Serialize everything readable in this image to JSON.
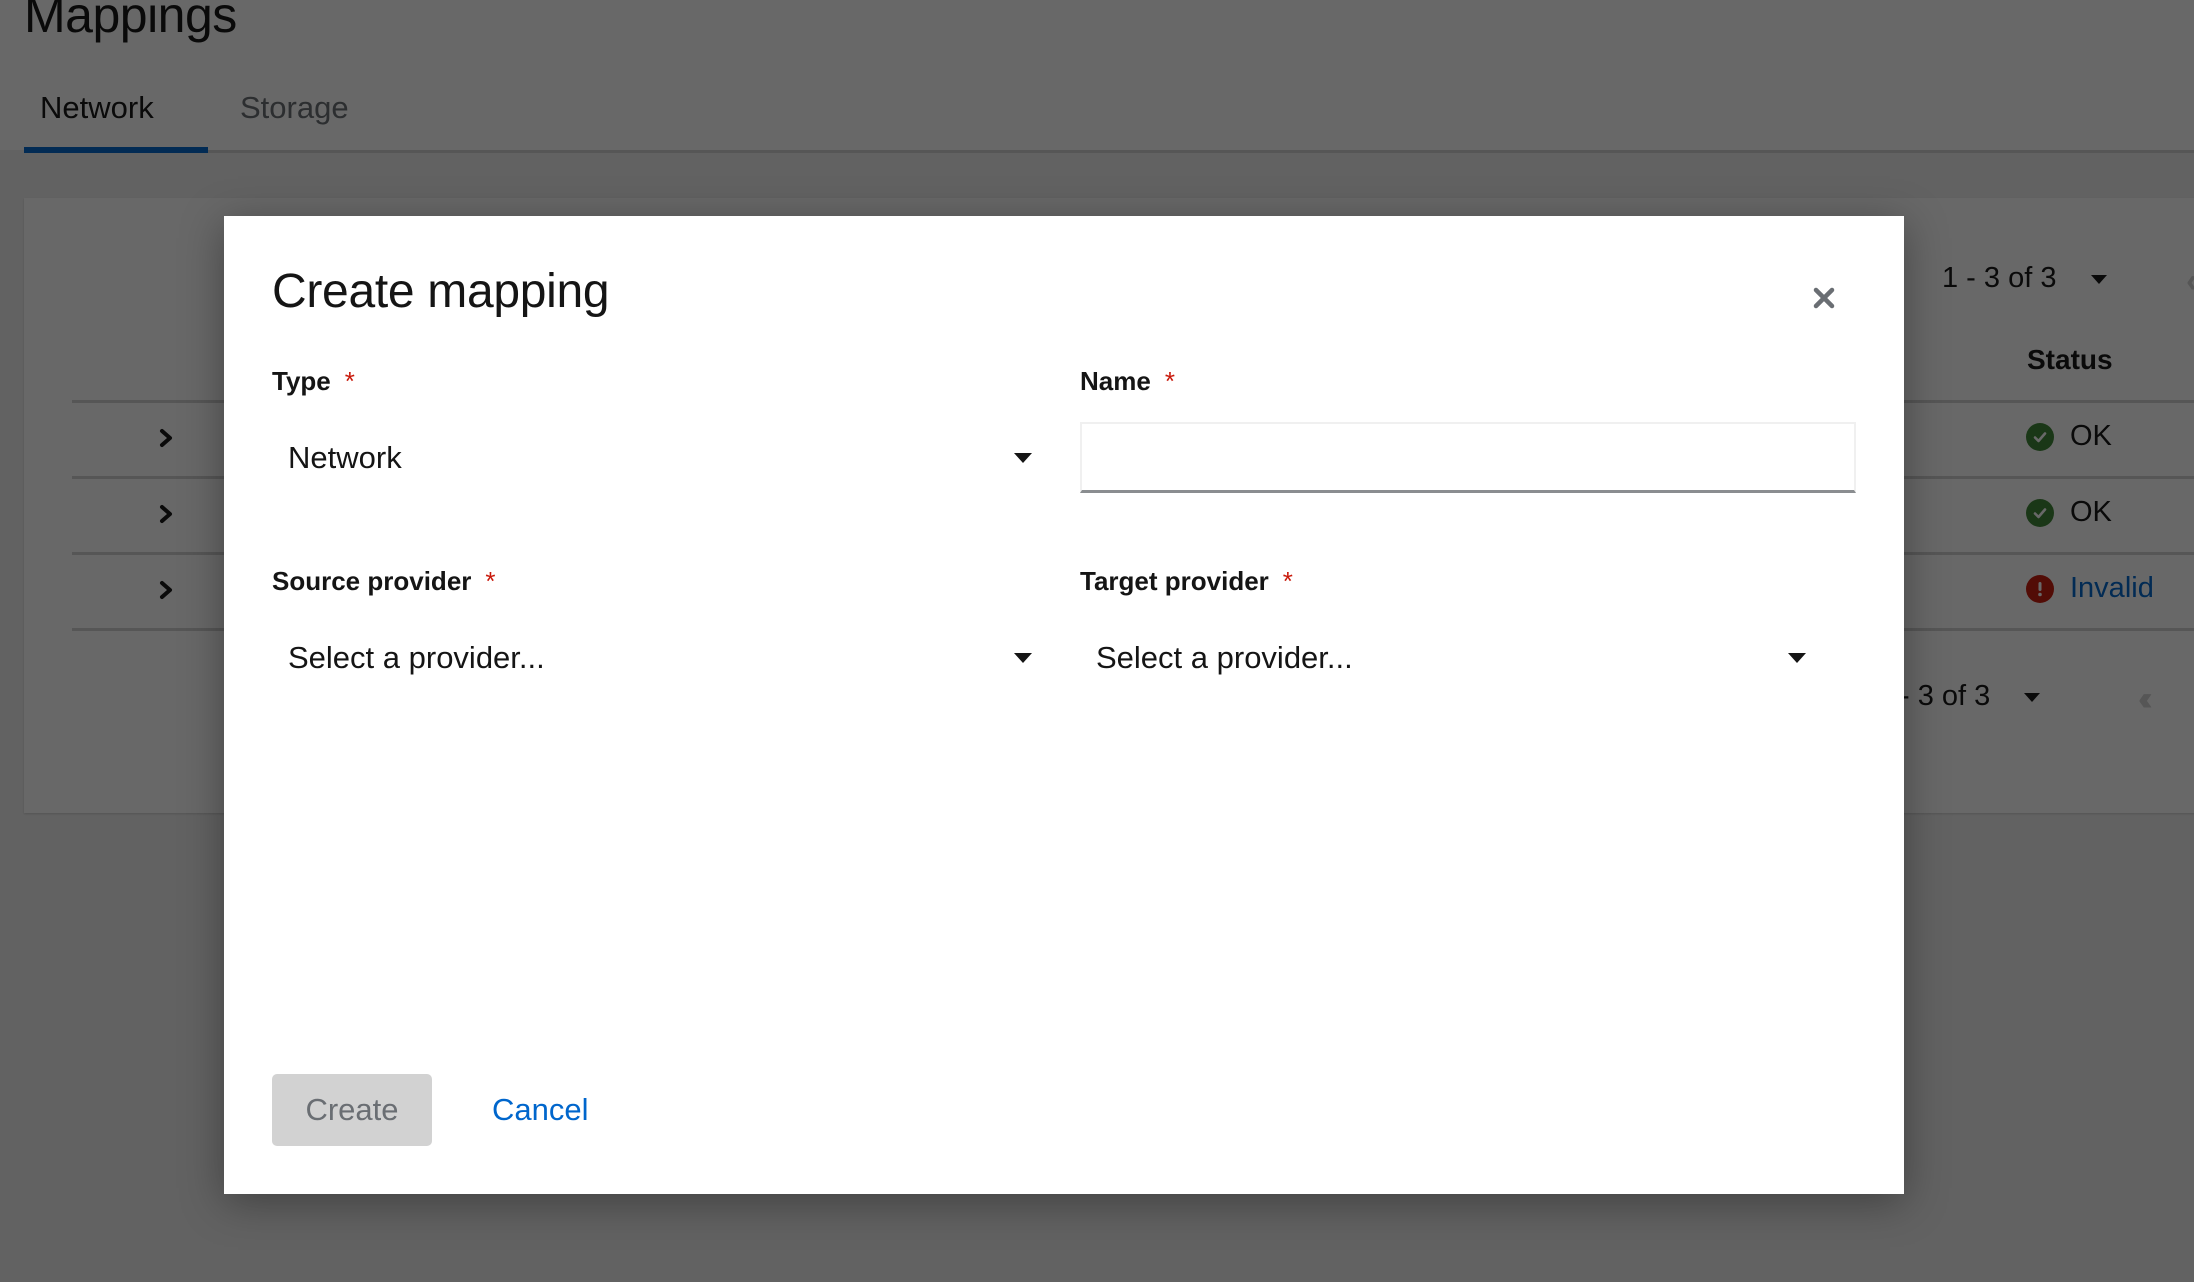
{
  "page": {
    "title": "Mappings",
    "tabs": [
      {
        "label": "Network",
        "active": true
      },
      {
        "label": "Storage",
        "active": false
      }
    ]
  },
  "table": {
    "pagination_top": {
      "range": "1 - 3",
      "of_label": "of",
      "total": "3"
    },
    "pagination_bottom": {
      "range_partial": "- 3",
      "of_label": "of",
      "total": "3"
    },
    "columns": [
      "Status"
    ],
    "rows": [
      {
        "status": "OK",
        "status_type": "ok"
      },
      {
        "status": "OK",
        "status_type": "ok"
      },
      {
        "status": "Invalid",
        "status_type": "error"
      }
    ]
  },
  "modal": {
    "title": "Create mapping",
    "fields": {
      "type": {
        "label": "Type",
        "required_mark": "*",
        "value": "Network"
      },
      "name": {
        "label": "Name",
        "required_mark": "*",
        "value": "",
        "placeholder": ""
      },
      "source_provider": {
        "label": "Source provider",
        "required_mark": "*",
        "value": "Select a provider..."
      },
      "target_provider": {
        "label": "Target provider",
        "required_mark": "*",
        "value": "Select a provider..."
      }
    },
    "buttons": {
      "create": "Create",
      "cancel": "Cancel"
    }
  },
  "colors": {
    "accent": "#0066cc",
    "success": "#3e8635",
    "danger": "#c9190b",
    "required": "#c9190b",
    "disabled_bg": "#d2d2d2"
  }
}
